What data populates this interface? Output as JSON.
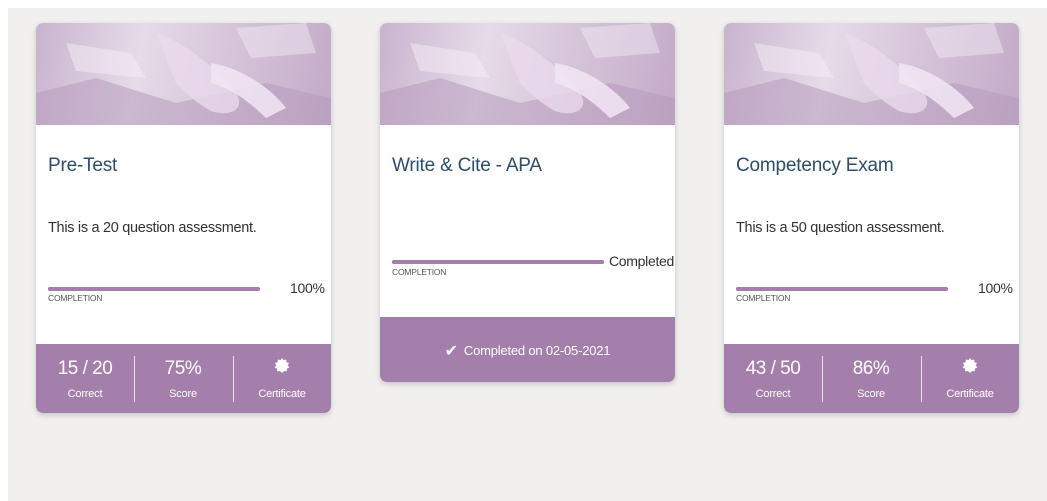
{
  "colors": {
    "accent": "#a47fab",
    "title": "#2d4d6e",
    "background": "#f1f0ef"
  },
  "cards": [
    {
      "title": "Pre-Test",
      "description": "This is a 20 question assessment.",
      "completion_label": "COMPLETION",
      "completion_value": "100%",
      "completion_fraction": 1.0,
      "stats": [
        {
          "value": "15 / 20",
          "label": "Correct"
        },
        {
          "value": "75%",
          "label": "Score"
        },
        {
          "label": "Certificate",
          "icon": "certificate-icon"
        }
      ]
    },
    {
      "title": "Write & Cite - APA",
      "completion_label": "COMPLETION",
      "completion_value": "Completed",
      "completion_fraction": 1.0,
      "footer_text": "Completed on 02-05-2021",
      "footer_icon": "checkmark-icon"
    },
    {
      "title": "Competency Exam",
      "description": "This is a 50 question assessment.",
      "completion_label": "COMPLETION",
      "completion_value": "100%",
      "completion_fraction": 1.0,
      "stats": [
        {
          "value": "43 / 50",
          "label": "Correct"
        },
        {
          "value": "86%",
          "label": "Score"
        },
        {
          "label": "Certificate",
          "icon": "certificate-icon"
        }
      ]
    }
  ]
}
